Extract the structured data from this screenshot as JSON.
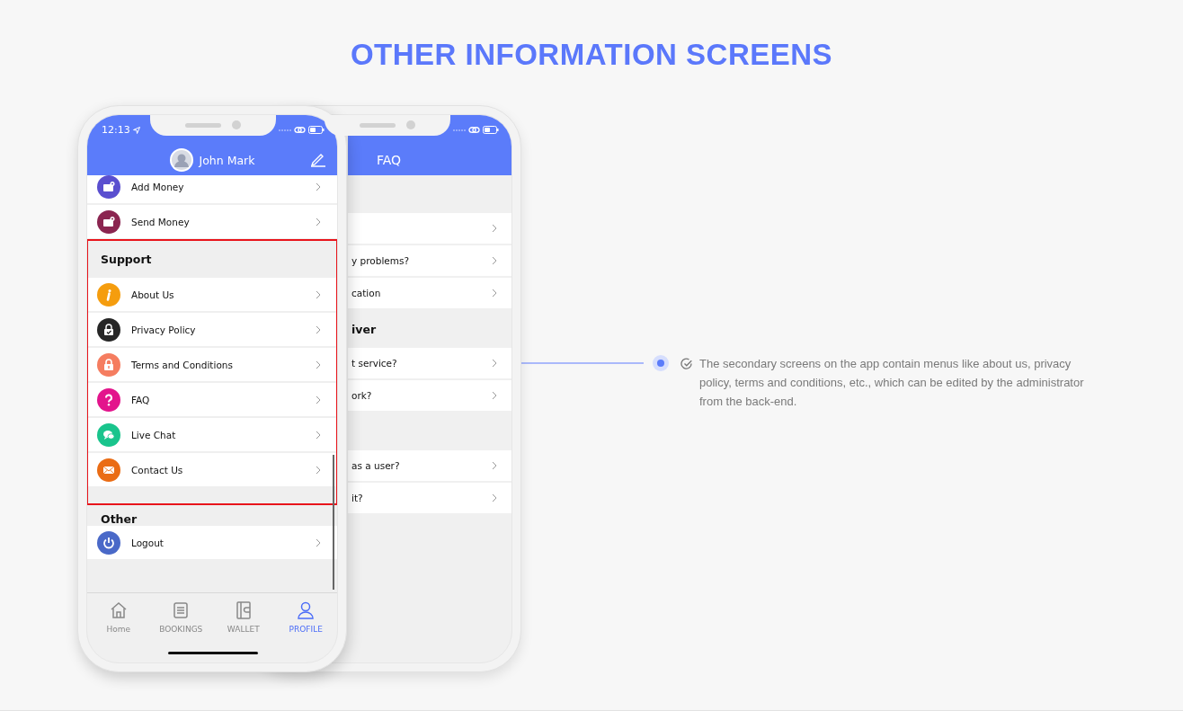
{
  "page_title": "OTHER INFORMATION SCREENS",
  "front_phone": {
    "status_time": "12:13",
    "profile_name": "John Mark",
    "groups": [
      {
        "highlighted": false,
        "items": [
          {
            "label": "Add Money",
            "kind": "wallet",
            "color": "#5a4fcf"
          },
          {
            "label": "Send Money",
            "kind": "wallet",
            "color": "#8b2550"
          }
        ]
      },
      {
        "header": "Support",
        "highlighted": true,
        "items": [
          {
            "label": "About Us",
            "kind": "info",
            "color": "#f59d0e"
          },
          {
            "label": "Privacy Policy",
            "kind": "verified",
            "color": "#262626"
          },
          {
            "label": "Terms and Conditions",
            "kind": "lock",
            "color": "#f57d60"
          },
          {
            "label": "FAQ",
            "kind": "question",
            "color": "#e3148c"
          },
          {
            "label": "Live Chat",
            "kind": "chat",
            "color": "#19c48c"
          },
          {
            "label": "Contact Us",
            "kind": "mail",
            "color": "#ea6c14"
          }
        ]
      },
      {
        "header": "Other",
        "highlighted": false,
        "items": [
          {
            "label": "Logout",
            "kind": "power",
            "color": "#4a69c8"
          }
        ]
      }
    ],
    "tabs": [
      {
        "label": "Home",
        "selected": false
      },
      {
        "label": "BOOKINGS",
        "selected": false
      },
      {
        "label": "WALLET",
        "selected": false
      },
      {
        "label": "PROFILE",
        "selected": true
      }
    ]
  },
  "back_phone": {
    "title": "FAQ",
    "rows": [
      {
        "kind": "section"
      },
      {
        "kind": "item"
      },
      {
        "kind": "item",
        "text": "y problems?"
      },
      {
        "kind": "item",
        "text": "cation"
      },
      {
        "kind": "section",
        "text": "iver"
      },
      {
        "kind": "item",
        "text": "t service?"
      },
      {
        "kind": "item",
        "text": "ork?"
      },
      {
        "kind": "section"
      },
      {
        "kind": "item",
        "text": "as a user?"
      },
      {
        "kind": "item",
        "text": "it?"
      }
    ]
  },
  "description": "The secondary screens on the app contain menus like about us, privacy policy, terms and conditions, etc., which can be edited by the administrator from the back-end."
}
